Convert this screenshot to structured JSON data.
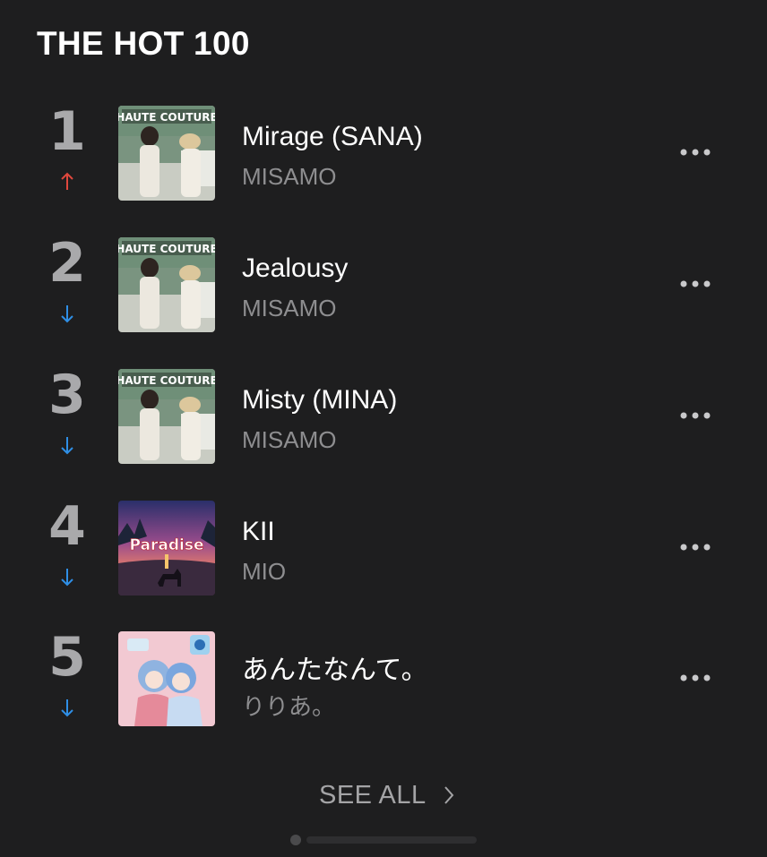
{
  "title": "THE HOT 100",
  "see_all_label": "SEE ALL",
  "trend_colors": {
    "up": "#e0483d",
    "down": "#2f8fe6"
  },
  "rows": [
    {
      "rank": "1",
      "trend": "up",
      "song": "Mirage (SANA)",
      "artist": "MISAMO",
      "cover": "HAUTE COUTURE"
    },
    {
      "rank": "2",
      "trend": "down",
      "song": "Jealousy",
      "artist": "MISAMO",
      "cover": "HAUTE COUTURE"
    },
    {
      "rank": "3",
      "trend": "down",
      "song": "Misty (MINA)",
      "artist": "MISAMO",
      "cover": "HAUTE COUTURE"
    },
    {
      "rank": "4",
      "trend": "down",
      "song": "KII",
      "artist": "MIO",
      "cover": "Paradise"
    },
    {
      "rank": "5",
      "trend": "down",
      "song": "あんたなんて。",
      "artist": "りりあ。",
      "cover": ""
    }
  ]
}
